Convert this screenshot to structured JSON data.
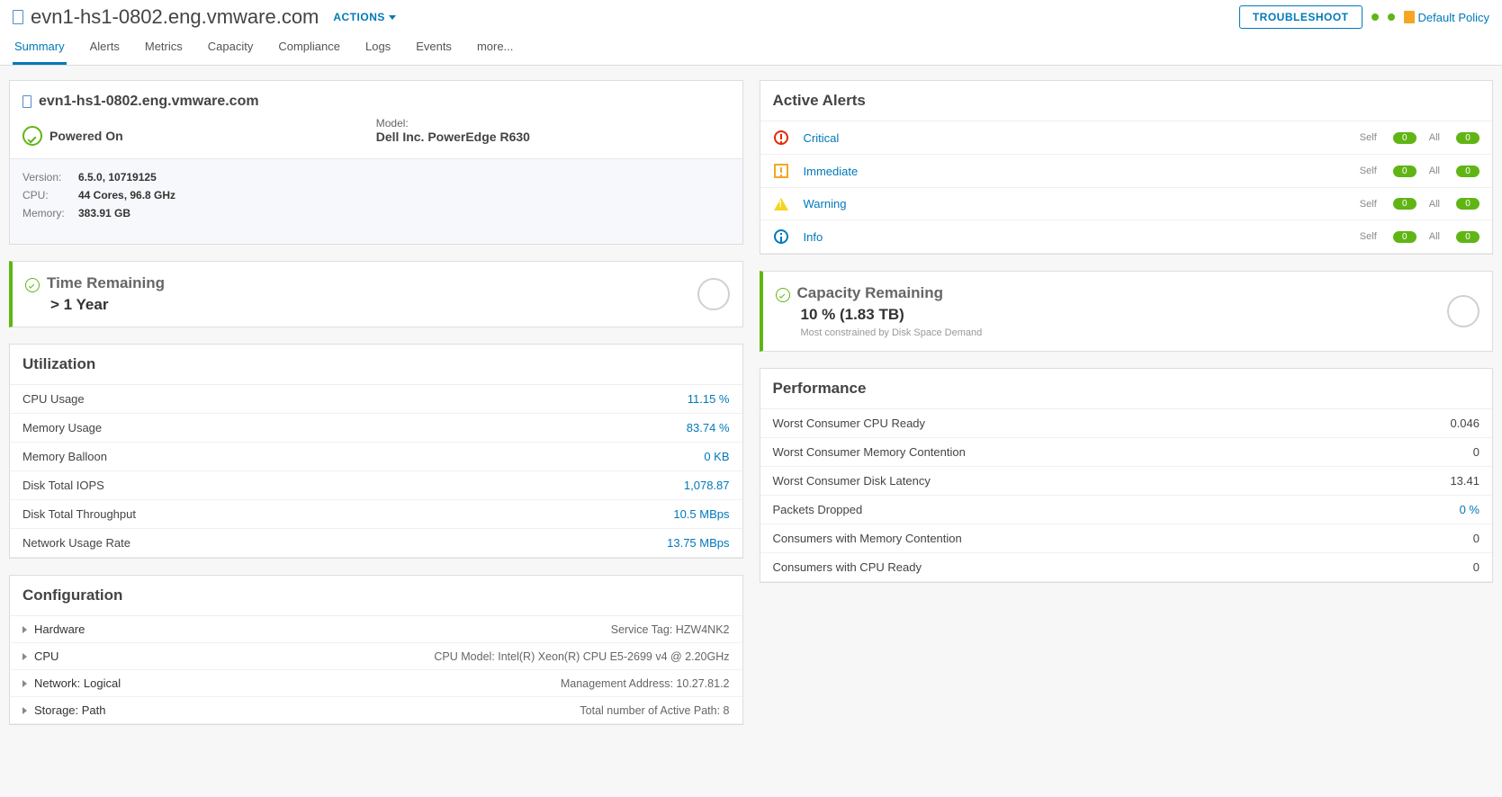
{
  "header": {
    "title": "evn1-hs1-0802.eng.vmware.com",
    "actions_label": "ACTIONS",
    "troubleshoot_label": "TROUBLESHOOT",
    "policy_label": "Default Policy"
  },
  "tabs": [
    "Summary",
    "Alerts",
    "Metrics",
    "Capacity",
    "Compliance",
    "Logs",
    "Events",
    "more..."
  ],
  "summary": {
    "hostname": "evn1-hs1-0802.eng.vmware.com",
    "power_state": "Powered On",
    "model_label": "Model:",
    "model": "Dell Inc. PowerEdge R630",
    "specs": [
      {
        "label": "Version:",
        "value": "6.5.0, 10719125"
      },
      {
        "label": "CPU:",
        "value": "44 Cores, 96.8 GHz"
      },
      {
        "label": "Memory:",
        "value": "383.91 GB"
      }
    ]
  },
  "active_alerts": {
    "title": "Active Alerts",
    "self_label": "Self",
    "all_label": "All",
    "rows": [
      {
        "label": "Critical",
        "self": "0",
        "all": "0",
        "icon": "critical"
      },
      {
        "label": "Immediate",
        "self": "0",
        "all": "0",
        "icon": "immediate"
      },
      {
        "label": "Warning",
        "self": "0",
        "all": "0",
        "icon": "warning"
      },
      {
        "label": "Info",
        "self": "0",
        "all": "0",
        "icon": "info"
      }
    ]
  },
  "time_remaining": {
    "title": "Time Remaining",
    "value": "> 1 Year"
  },
  "capacity_remaining": {
    "title": "Capacity Remaining",
    "value": "10 % (1.83 TB)",
    "sub": "Most constrained by Disk Space Demand"
  },
  "utilization": {
    "title": "Utilization",
    "rows": [
      {
        "label": "CPU Usage",
        "value": "11.15 %"
      },
      {
        "label": "Memory Usage",
        "value": "83.74 %"
      },
      {
        "label": "Memory Balloon",
        "value": "0 KB"
      },
      {
        "label": "Disk Total IOPS",
        "value": "1,078.87"
      },
      {
        "label": "Disk Total Throughput",
        "value": "10.5 MBps"
      },
      {
        "label": "Network Usage Rate",
        "value": "13.75 MBps"
      }
    ]
  },
  "performance": {
    "title": "Performance",
    "rows": [
      {
        "label": "Worst Consumer CPU Ready",
        "value": "0.046",
        "link": false
      },
      {
        "label": "Worst Consumer Memory Contention",
        "value": "0",
        "link": false
      },
      {
        "label": "Worst Consumer Disk Latency",
        "value": "13.41",
        "link": false
      },
      {
        "label": "Packets Dropped",
        "value": "0 %",
        "link": true
      },
      {
        "label": "Consumers with Memory Contention",
        "value": "0",
        "link": false
      },
      {
        "label": "Consumers with CPU Ready",
        "value": "0",
        "link": false
      }
    ]
  },
  "configuration": {
    "title": "Configuration",
    "rows": [
      {
        "label": "Hardware",
        "value": "Service Tag: HZW4NK2"
      },
      {
        "label": "CPU",
        "value": "CPU Model: Intel(R) Xeon(R) CPU E5-2699 v4 @ 2.20GHz"
      },
      {
        "label": "Network: Logical",
        "value": "Management Address: 10.27.81.2"
      },
      {
        "label": "Storage: Path",
        "value": "Total number of Active Path: 8"
      }
    ]
  }
}
